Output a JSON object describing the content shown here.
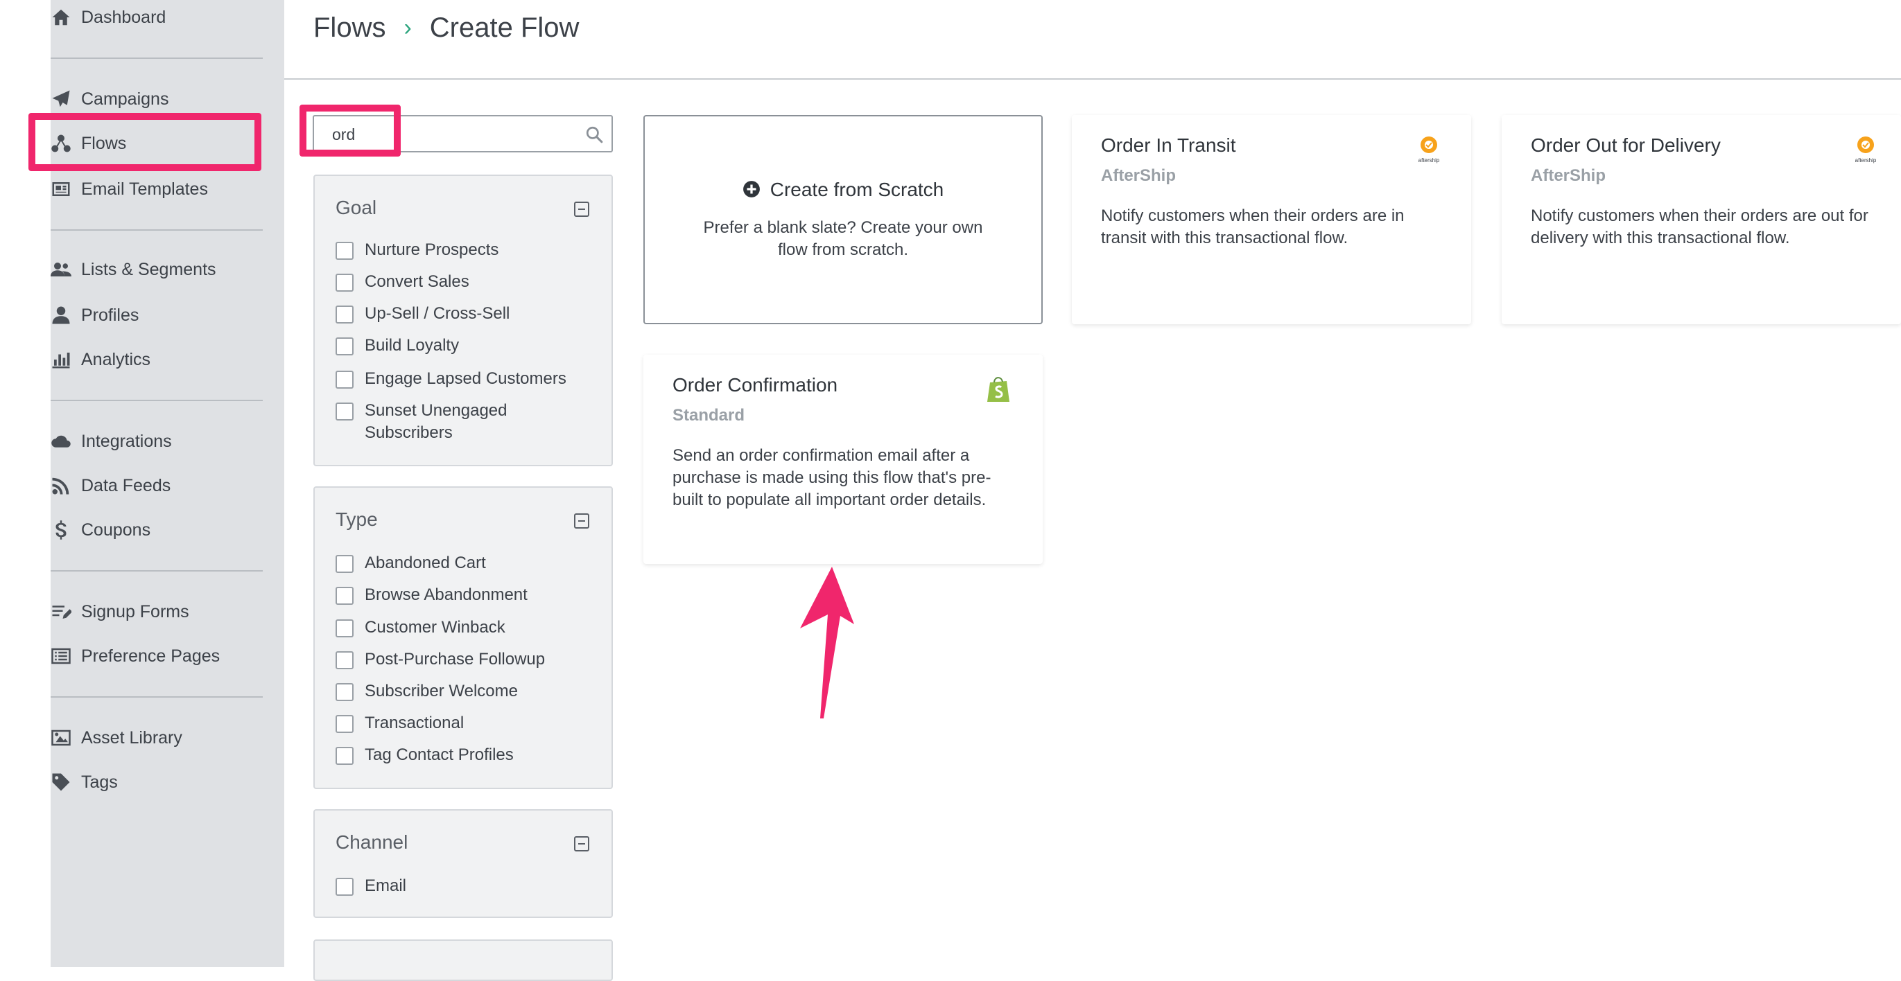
{
  "sidebar": {
    "items": [
      {
        "label": "Dashboard",
        "icon": "home-icon"
      },
      {
        "label": "Campaigns",
        "icon": "paper-plane-icon"
      },
      {
        "label": "Flows",
        "icon": "flows-icon"
      },
      {
        "label": "Email Templates",
        "icon": "email-template-icon"
      },
      {
        "label": "Lists & Segments",
        "icon": "users-icon"
      },
      {
        "label": "Profiles",
        "icon": "user-icon"
      },
      {
        "label": "Analytics",
        "icon": "bar-chart-icon"
      },
      {
        "label": "Integrations",
        "icon": "cloud-icon"
      },
      {
        "label": "Data Feeds",
        "icon": "rss-icon"
      },
      {
        "label": "Coupons",
        "icon": "dollar-icon"
      },
      {
        "label": "Signup Forms",
        "icon": "form-icon"
      },
      {
        "label": "Preference Pages",
        "icon": "list-icon"
      },
      {
        "label": "Asset Library",
        "icon": "image-icon"
      },
      {
        "label": "Tags",
        "icon": "tag-icon"
      }
    ],
    "active_item": "Flows"
  },
  "breadcrumb": {
    "parent": "Flows",
    "separator": "›",
    "current": "Create Flow"
  },
  "search": {
    "value": "ord",
    "placeholder": ""
  },
  "filters": {
    "goal": {
      "title": "Goal",
      "options": [
        "Nurture Prospects",
        "Convert Sales",
        "Up-Sell / Cross-Sell",
        "Build Loyalty",
        "Engage Lapsed Customers",
        "Sunset Unengaged Subscribers"
      ]
    },
    "type": {
      "title": "Type",
      "options": [
        "Abandoned Cart",
        "Browse Abandonment",
        "Customer Winback",
        "Post-Purchase Followup",
        "Subscriber Welcome",
        "Transactional",
        "Tag Contact Profiles"
      ]
    },
    "channel": {
      "title": "Channel",
      "options": [
        "Email"
      ]
    }
  },
  "cards": {
    "scratch": {
      "title": "Create from Scratch",
      "description": "Prefer a blank slate? Create your own flow from scratch."
    },
    "order_in_transit": {
      "title": "Order In Transit",
      "source": "AfterShip",
      "description": "Notify customers when their orders are in transit with this transactional flow.",
      "logo_text": "aftership"
    },
    "order_out_for_delivery": {
      "title": "Order Out for Delivery",
      "source": "AfterShip",
      "description": "Notify customers when their orders are out for delivery with this transactional flow.",
      "logo_text": "aftership"
    },
    "order_confirmation": {
      "title": "Order Confirmation",
      "source": "Standard",
      "description": "Send an order confirmation email after a purchase is made using this flow that's pre-built to populate all important order details."
    }
  },
  "colors": {
    "highlight": "#f0266c",
    "sidebar_bg": "#dfe1e4",
    "breadcrumb_separator": "#2ba47d",
    "aftership_orange": "#f7a21b",
    "shopify_green": "#95bf47"
  }
}
